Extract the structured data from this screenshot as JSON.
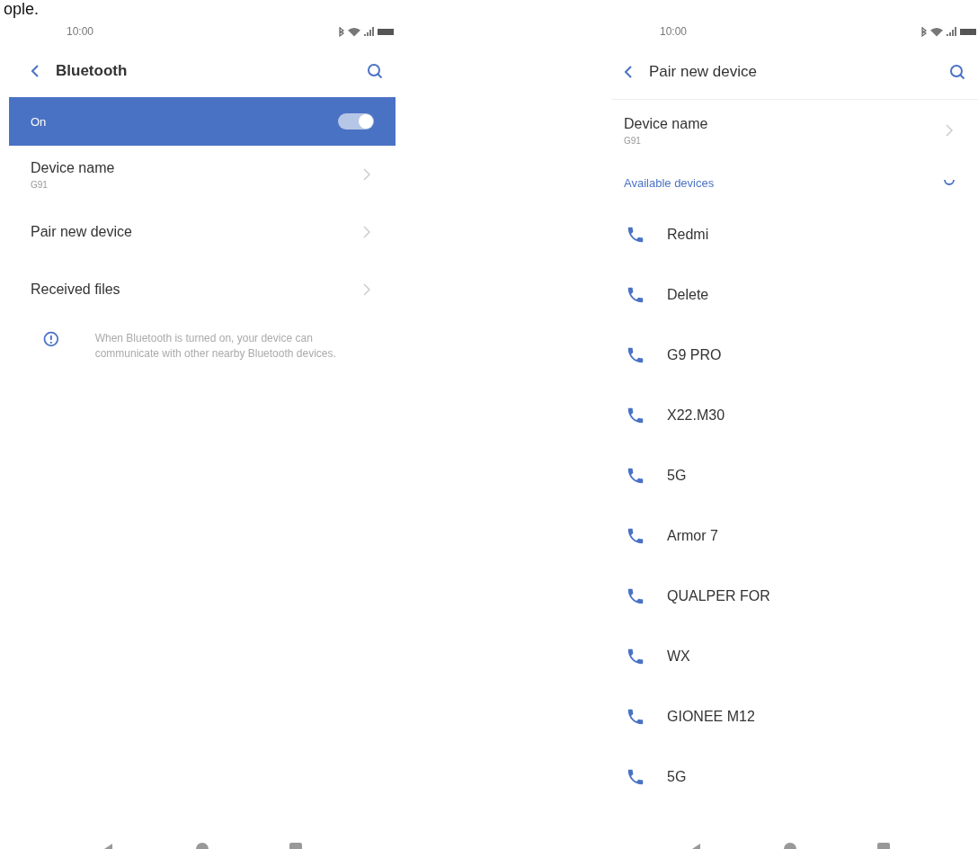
{
  "page_fragment": "ople.",
  "screens": [
    {
      "status_bar": {
        "time": "10:00"
      },
      "header": {
        "title": "Bluetooth"
      },
      "toggle": {
        "label": "On",
        "on": true
      },
      "rows": [
        {
          "title": "Device name",
          "subtitle": "G91"
        },
        {
          "title": "Pair new device"
        },
        {
          "title": "Received files"
        }
      ],
      "info": "When Bluetooth is turned on, your device can communicate with other nearby Bluetooth devices."
    },
    {
      "status_bar": {
        "time": "10:00"
      },
      "header": {
        "title": "Pair new device"
      },
      "rows": [
        {
          "title": "Device name",
          "subtitle": "G91"
        }
      ],
      "section": {
        "label": "Available devices"
      },
      "devices": [
        {
          "name": "Redmi"
        },
        {
          "name": "Delete"
        },
        {
          "name": "G9 PRO"
        },
        {
          "name": "X22.M30"
        },
        {
          "name": "5G"
        },
        {
          "name": "Armor 7"
        },
        {
          "name": "QUALPER FOR"
        },
        {
          "name": "WX"
        },
        {
          "name": "GIONEE M12"
        },
        {
          "name": "5G"
        }
      ]
    }
  ]
}
